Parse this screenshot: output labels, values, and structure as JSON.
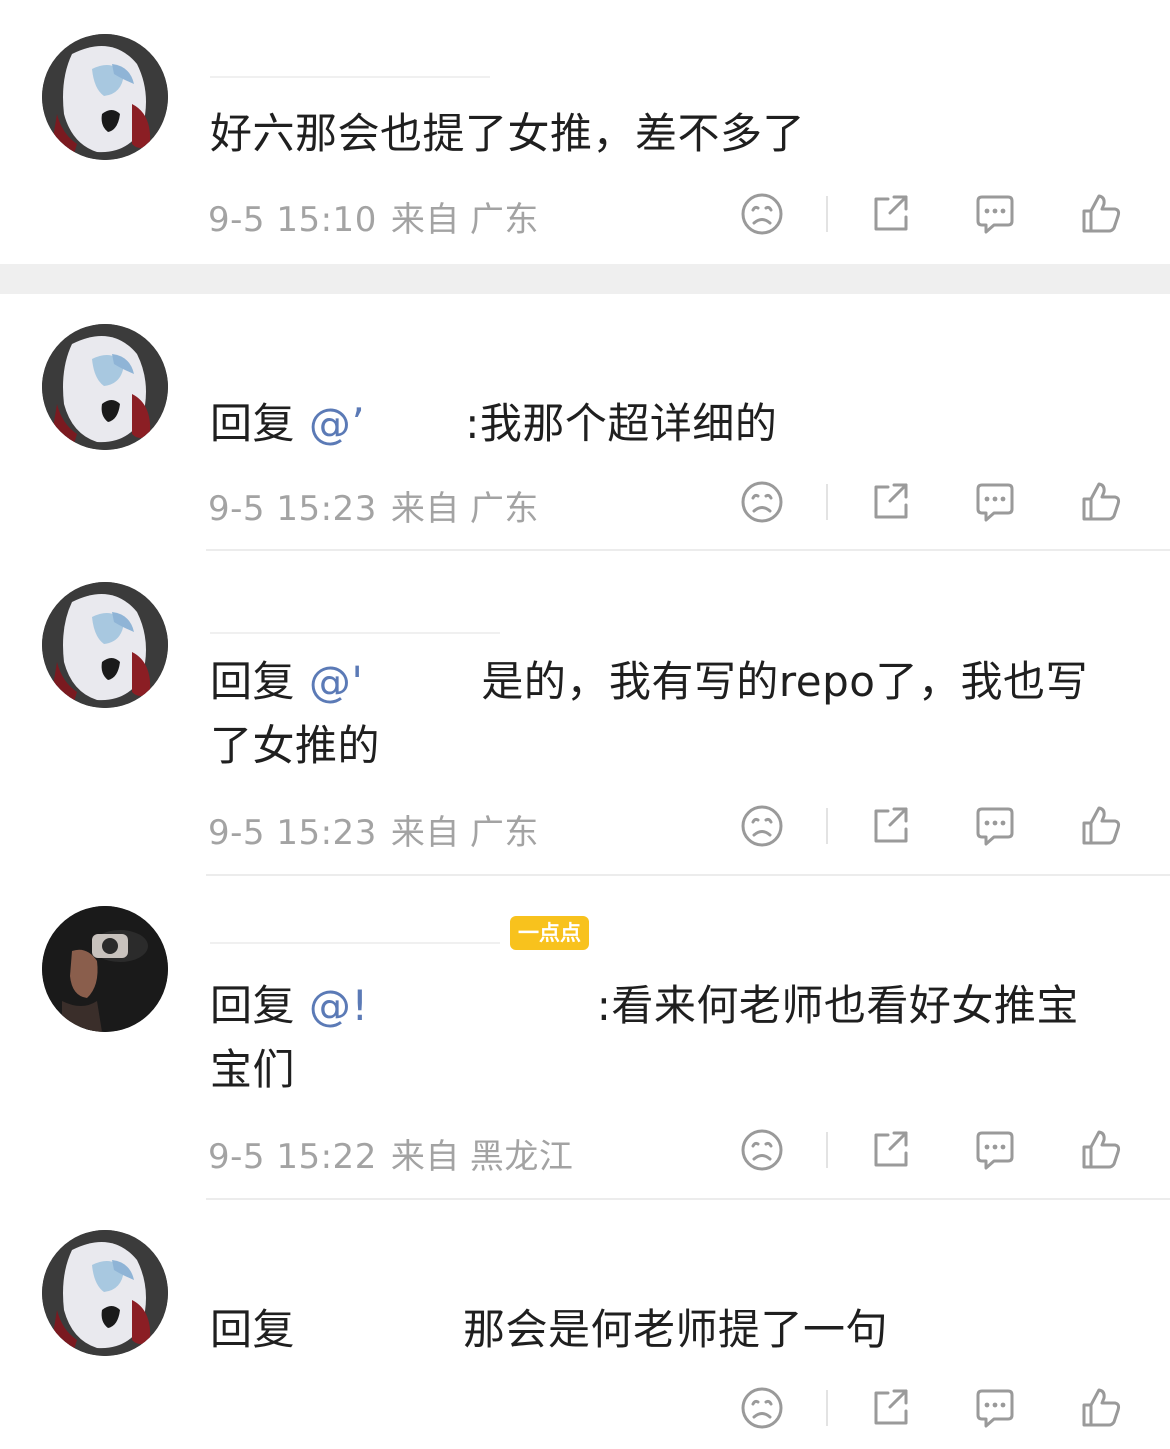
{
  "comments": [
    {
      "avatar": "ultraman-avatar",
      "text_parts": {
        "reply": "",
        "mention": "",
        "body": "好六那会也提了女推，差不多了"
      },
      "time": "9-5 15:10",
      "source_prefix": "来自",
      "location": "广东"
    },
    {
      "avatar": "ultraman-avatar",
      "text_parts": {
        "reply": "回复",
        "mention": "@’",
        "body": ":我那个超详细的"
      },
      "time": "9-5 15:23",
      "source_prefix": "来自",
      "location": "广东"
    },
    {
      "avatar": "ultraman-avatar",
      "text_parts": {
        "reply": "回复",
        "mention": "@'",
        "body": "是的，我有写的repo了，我也写了女推的"
      },
      "time": "9-5 15:23",
      "source_prefix": "来自",
      "location": "广东"
    },
    {
      "avatar": "dark-camera-avatar",
      "badge": "一点点",
      "text_parts": {
        "reply": "回复",
        "mention": "@!",
        "body": ":看来何老师也看好女推宝宝们"
      },
      "time": "9-5 15:22",
      "source_prefix": "来自",
      "location": "黑龙江"
    },
    {
      "avatar": "ultraman-avatar",
      "text_parts": {
        "reply": "回复",
        "mention": "",
        "body": "那会是何老师提了一句"
      },
      "time": "",
      "source_prefix": "",
      "location": ""
    }
  ],
  "actions": [
    "sad-face-icon",
    "share-icon",
    "comment-icon",
    "like-icon"
  ],
  "colors": {
    "mention": "#5b7ab6",
    "meta": "#a3a3a3",
    "badge": "#f8c21d",
    "icon": "#9a9a9a"
  }
}
